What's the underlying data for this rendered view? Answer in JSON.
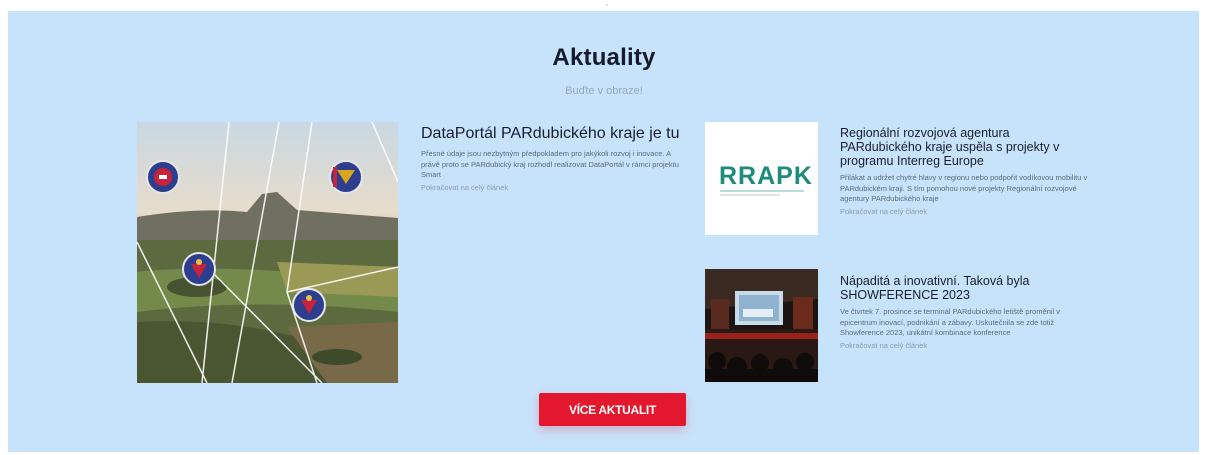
{
  "section": {
    "title": "Aktuality",
    "subtitle": "Buďte v obraze!"
  },
  "articles": [
    {
      "title": "DataPortál PARdubického kraje je tu",
      "excerpt": "Přesné údaje jsou nezbytným předpokladem pro jakýkoli rozvoj i inovace. A právě proto se PARdubický kraj rozhodl realizovat DataPortál v rámci projektu Smart",
      "more": "Pokračovat na celý článek"
    },
    {
      "title": "Regionální rozvojová agentura PARdubického kraje uspěla s projekty v programu Interreg Europe",
      "excerpt": "Přilákat a udržet chytré hlavy v regionu nebo podpořit vodíkovou mobilitu v PARdubickém kraji. S tím pomohou nové projekty Regionální rozvojové agentury PARdubického kraje",
      "more": "Pokračovat na celý článek",
      "logo_text": "RRAPK"
    },
    {
      "title": "Nápaditá a inovativní. Taková byla SHOWFERENCE 2023",
      "excerpt": "Ve čtvrtek 7. prosince se terminál PARdubického letiště proměnil v epicentrum inovací, podnikání a zábavy. Uskutečnila se zde totiž Showference 2023, unikátní kombinace konference",
      "more": "Pokračovat na celý článek"
    }
  ],
  "button": {
    "label": "VÍCE AKTUALIT"
  },
  "colors": {
    "panel": "#c7e3fb",
    "accent": "#e3172d",
    "logo": "#1f8b7a"
  }
}
